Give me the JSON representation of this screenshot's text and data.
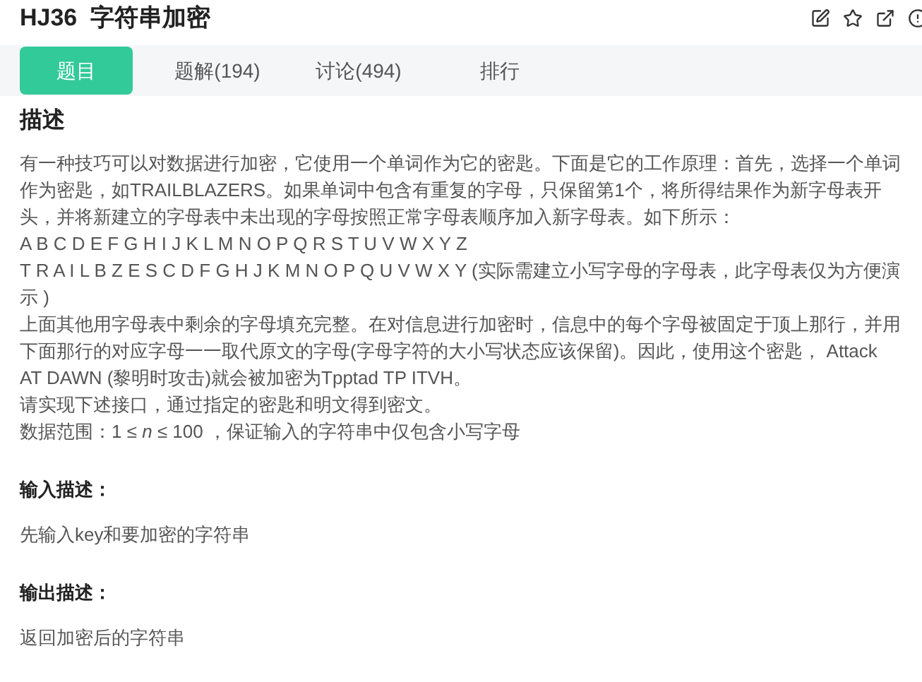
{
  "title": "HJ36  字符串加密",
  "tabs": [
    {
      "label": "题目",
      "selected": true
    },
    {
      "label": "题解(194)",
      "selected": false
    },
    {
      "label": "讨论(494)",
      "selected": false
    },
    {
      "label": "排行",
      "selected": false
    }
  ],
  "description": {
    "heading": "描述",
    "paragraphs": [
      "有一种技巧可以对数据进行加密，它使用一个单词作为它的密匙。下面是它的工作原理：首先，选择一个单词作为密匙，如TRAILBLAZERS。如果单词中包含有重复的字母，只保留第1个，将所得结果作为新字母表开头，并将新建立的字母表中未出现的字母按照正常字母表顺序加入新字母表。如下所示：",
      "A B C D E F G H I J K L M N O P Q R S T U V W X Y Z",
      "T R A I L B Z E S C D F G H J K M N O P Q U V W X Y (实际需建立小写字母的字母表，此字母表仅为方便演示 )",
      "上面其他用字母表中剩余的字母填充完整。在对信息进行加密时，信息中的每个字母被固定于顶上那行，并用下面那行的对应字母一一取代原文的字母(字母字符的大小写状态应该保留)。因此，使用这个密匙， Attack AT DAWN (黎明时攻击)就会被加密为Tpptad TP ITVH。",
      "请实现下述接口，通过指定的密匙和明文得到密文。",
      "数据范围：1 ≤ *n* ≤ 100 ，保证输入的字符串中仅包含小写字母"
    ]
  },
  "sections": [
    {
      "heading": "输入描述：",
      "text": "先输入key和要加密的字符串"
    },
    {
      "heading": "输出描述：",
      "text": "返回加密后的字符串"
    }
  ]
}
